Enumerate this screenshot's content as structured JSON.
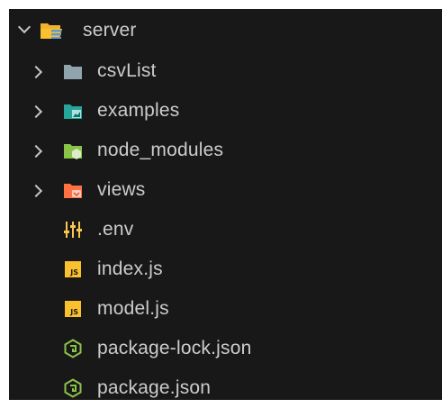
{
  "explorer": {
    "root": {
      "label": "server",
      "icon": "folder-open-server-icon",
      "expanded": true
    },
    "items": [
      {
        "label": "csvList",
        "type": "folder",
        "icon": "folder-icon",
        "color": "#90a4ae"
      },
      {
        "label": "examples",
        "type": "folder",
        "icon": "folder-images-icon",
        "color": "#26a69a"
      },
      {
        "label": "node_modules",
        "type": "folder",
        "icon": "folder-node-icon",
        "color": "#8bc34a"
      },
      {
        "label": "views",
        "type": "folder",
        "icon": "folder-views-icon",
        "color": "#ff7043"
      },
      {
        "label": ".env",
        "type": "file",
        "icon": "env-settings-icon",
        "color": "#f9c74f"
      },
      {
        "label": "index.js",
        "type": "file",
        "icon": "javascript-icon",
        "color": "#fbc02d"
      },
      {
        "label": "model.js",
        "type": "file",
        "icon": "javascript-icon",
        "color": "#fbc02d"
      },
      {
        "label": "package-lock.json",
        "type": "file",
        "icon": "npm-package-icon",
        "color": "#8bc34a"
      },
      {
        "label": "package.json",
        "type": "file",
        "icon": "npm-package-icon",
        "color": "#8bc34a"
      }
    ]
  },
  "colors": {
    "background": "#181818",
    "text": "#cccccc",
    "chevron": "#c5c5c5"
  }
}
